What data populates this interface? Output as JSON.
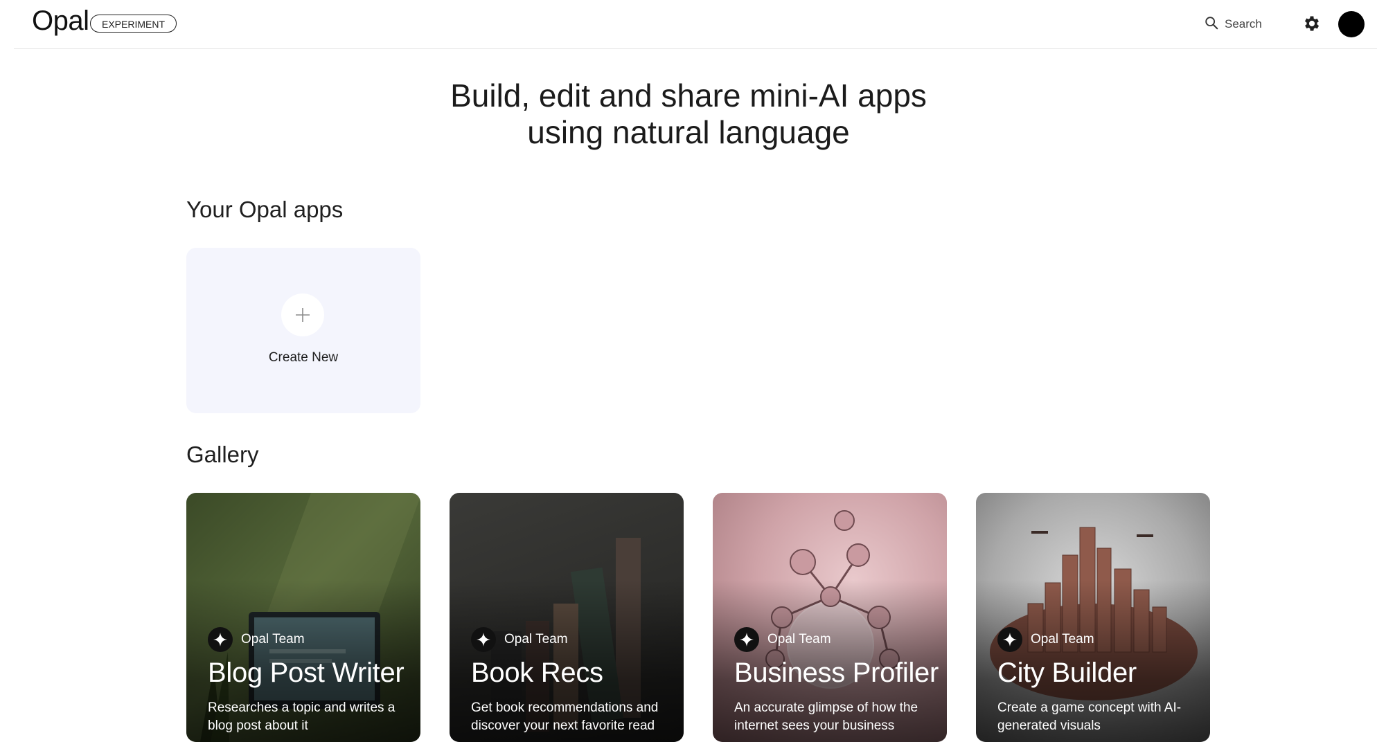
{
  "header": {
    "logo": "Opal",
    "badge": "EXPERIMENT",
    "search_label": "Search"
  },
  "hero": {
    "line1": "Build, edit and share mini-AI apps",
    "line2": "using natural language"
  },
  "your_apps": {
    "title": "Your Opal apps",
    "create_label": "Create New"
  },
  "gallery": {
    "title": "Gallery",
    "cards": [
      {
        "author": "Opal Team",
        "title": "Blog Post Writer",
        "desc": "Researches a topic and writes a blog post about it"
      },
      {
        "author": "Opal Team",
        "title": "Book Recs",
        "desc": "Get book recommendations and discover your next favorite read"
      },
      {
        "author": "Opal Team",
        "title": "Business Profiler",
        "desc": "An accurate glimpse of how the internet sees your business"
      },
      {
        "author": "Opal Team",
        "title": "City Builder",
        "desc": "Create a game concept with AI-generated visuals"
      }
    ]
  },
  "icons": {
    "search": "search-icon",
    "settings": "gear-icon",
    "add": "plus-icon",
    "author": "sparkle-icon"
  },
  "colors": {
    "create_card_bg": "#f4f5fd",
    "avatar": "#000000",
    "card1": "#4a5a33",
    "card2": "#2e2e2c",
    "card3": "#c9a0a4",
    "card4": "#8a8a8a"
  }
}
